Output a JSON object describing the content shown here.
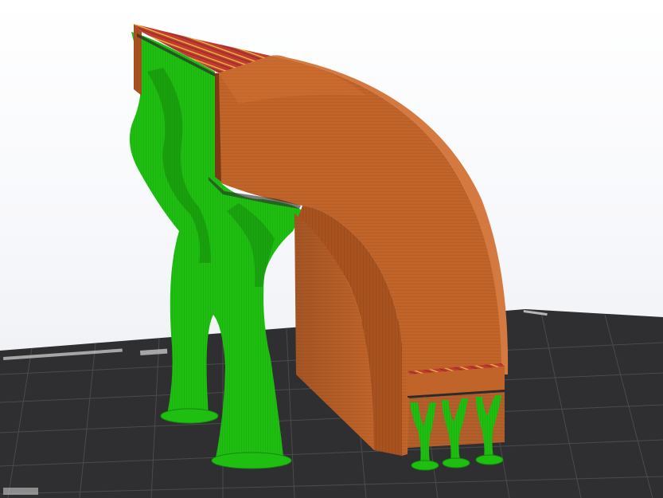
{
  "viewport": {
    "background_top": "#ffffff",
    "background_bottom": "#e9ebf0"
  },
  "build_plate": {
    "color": "#2f2f31",
    "grid_line_color": "#4b4b4e",
    "label_color": "#d8d8d8"
  },
  "model": {
    "shape": "quarter-arch",
    "wall_color": "#c0642a",
    "wall_dark_color": "#9e4e1e",
    "top_layer_color": "#c23a32",
    "top_layer_accent": "#e3b33a"
  },
  "supports": {
    "style": "tree",
    "color": "#1fbf12",
    "dark_color": "#14870a",
    "count_large": 2,
    "count_small": 3
  }
}
